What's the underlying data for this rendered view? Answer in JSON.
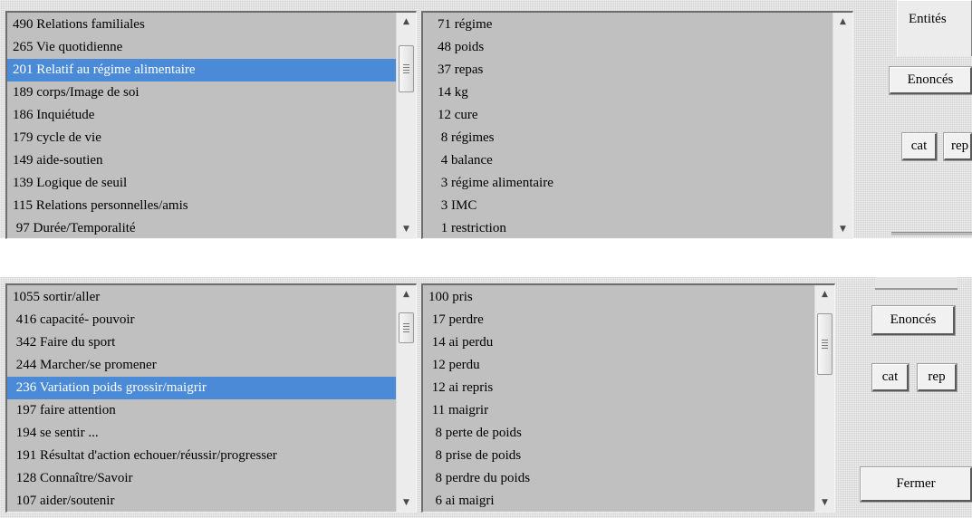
{
  "top": {
    "categories": [
      "490 Relations familiales",
      "265 Vie quotidienne",
      "201 Relatif au régime alimentaire",
      "189 corps/Image de soi",
      "186 Inquiétude",
      "179 cycle de vie",
      "149 aide-soutien",
      "139 Logique de seuil",
      "115 Relations personnelles/amis",
      " 97 Durée/Temporalité"
    ],
    "categories_selected": 2,
    "terms": [
      "71 régime",
      "48 poids",
      "37 repas",
      "14 kg",
      "12 cure",
      " 8 régimes",
      " 4 balance",
      " 3 régime alimentaire",
      " 3 IMC",
      " 1 restriction"
    ],
    "tab_label": "Entités",
    "enonces_label": "Enoncés",
    "cat_label": "cat",
    "rep_label": "rep"
  },
  "bottom": {
    "categories": [
      "1055 sortir/aller",
      " 416 capacité- pouvoir",
      " 342 Faire du sport",
      " 244 Marcher/se promener",
      " 236 Variation poids grossir/maigrir",
      " 197 faire attention",
      " 194 se sentir ...",
      " 191 Résultat d'action echouer/réussir/progresser",
      " 128 Connaître/Savoir",
      " 107 aider/soutenir"
    ],
    "categories_selected": 4,
    "terms": [
      "100 pris",
      " 17 perdre",
      " 14 ai perdu",
      " 12 perdu",
      " 12 ai repris",
      " 11 maigrir",
      "  8 perte de poids",
      "  8 prise de poids",
      "  8 perdre du poids",
      "  6 ai maigri"
    ],
    "enonces_label": "Enoncés",
    "cat_label": "cat",
    "rep_label": "rep",
    "fermer_label": "Fermer"
  },
  "icons": {
    "scroll_up": "▲",
    "scroll_down": "▼"
  }
}
